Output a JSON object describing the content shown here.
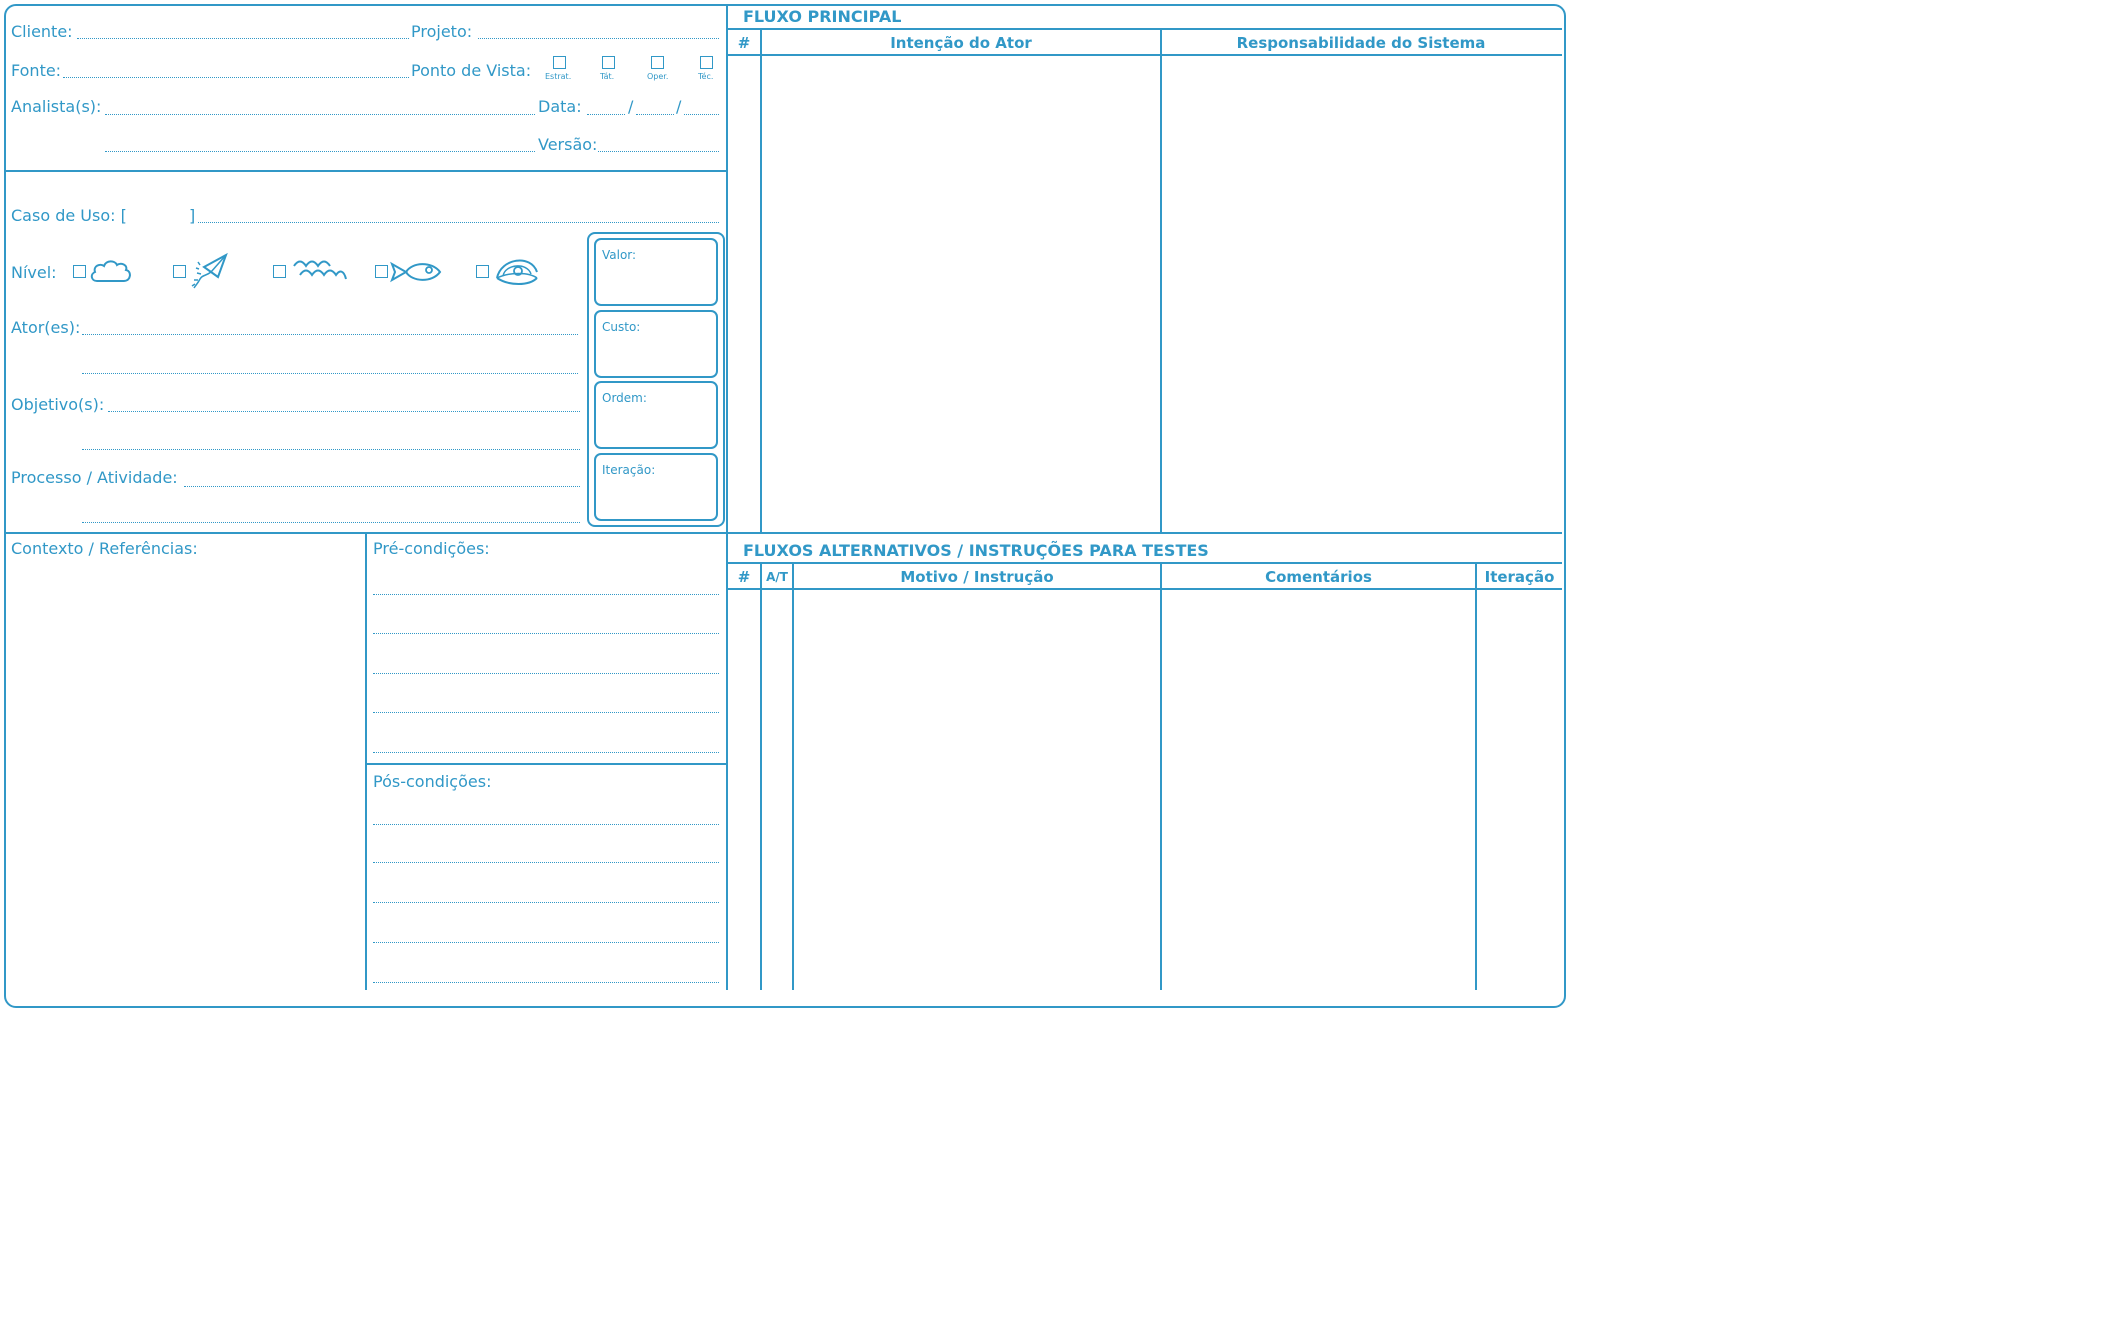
{
  "header": {
    "cliente": "Cliente:",
    "projeto": "Projeto:",
    "fonte": "Fonte:",
    "ponto_de_vista": "Ponto de Vista:",
    "pv_options": [
      "Estrat.",
      "Tát.",
      "Oper.",
      "Téc."
    ],
    "analistas": "Analista(s):",
    "data": "Data:",
    "slash": "/",
    "versao": "Versão:"
  },
  "use_case": {
    "caso_de_uso": "Caso de Uso: [",
    "bracket_close": "]",
    "nivel": "Nível:",
    "nivel_icons": [
      "cloud-icon",
      "kite-icon",
      "waves-icon",
      "fish-icon",
      "clam-icon"
    ],
    "atores": "Ator(es):",
    "objetivos": "Objetivo(s):",
    "processo": "Processo / Atividade:",
    "boxes": [
      "Valor:",
      "Custo:",
      "Ordem:",
      "Iteração:"
    ]
  },
  "bottom_left": {
    "contexto": "Contexto / Referências:",
    "pre": "Pré-condições:",
    "pos": "Pós-condições:"
  },
  "fluxo_principal": {
    "title": "FLUXO PRINCIPAL",
    "columns": [
      "#",
      "Intenção do Ator",
      "Responsabilidade do Sistema"
    ]
  },
  "fluxos_alternativos": {
    "title": "FLUXOS ALTERNATIVOS / INSTRUÇÕES PARA TESTES",
    "columns": [
      "#",
      "A/T",
      "Motivo / Instrução",
      "Comentários",
      "Iteração"
    ]
  },
  "colors": {
    "accent": "#3198c7"
  }
}
